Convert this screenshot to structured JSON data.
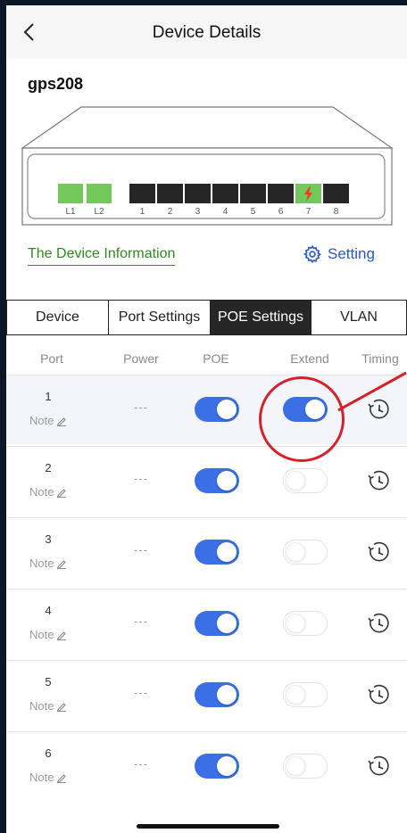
{
  "header": {
    "title": "Device Details"
  },
  "device": {
    "name": "gps208"
  },
  "switch_ports": {
    "uplinks": [
      "L1",
      "L2"
    ],
    "ports": [
      "1",
      "2",
      "3",
      "4",
      "5",
      "6",
      "7",
      "8"
    ]
  },
  "links": {
    "device_info": "The Device Information",
    "setting": "Setting"
  },
  "tabs": [
    {
      "label": "Device"
    },
    {
      "label": "Port Settings"
    },
    {
      "label": "POE Settings",
      "active": true
    },
    {
      "label": "VLAN"
    }
  ],
  "columns": {
    "port": "Port",
    "power": "Power",
    "poe": "POE",
    "extend": "Extend",
    "timing": "Timing"
  },
  "rows": [
    {
      "port": "1",
      "note": "Note",
      "power": "---",
      "poe": true,
      "extend": true
    },
    {
      "port": "2",
      "note": "Note",
      "power": "---",
      "poe": true,
      "extend": false
    },
    {
      "port": "3",
      "note": "Note",
      "power": "---",
      "poe": true,
      "extend": false
    },
    {
      "port": "4",
      "note": "Note",
      "power": "---",
      "poe": true,
      "extend": false
    },
    {
      "port": "5",
      "note": "Note",
      "power": "---",
      "poe": true,
      "extend": false
    },
    {
      "port": "6",
      "note": "Note",
      "power": "---",
      "poe": true,
      "extend": false
    }
  ],
  "colors": {
    "toggle_on": "#3b6fe3",
    "link_green": "#2f8a1e",
    "link_blue": "#2a56c8",
    "uplink_port": "#72c95a",
    "active_port": "#72c95a",
    "port_dark": "#262626",
    "annotation": "#d4212a"
  },
  "icons": {
    "back": "chevron-left-icon",
    "setting": "gear-icon",
    "note": "pencil-icon",
    "timing": "clock-timer-icon",
    "poe_active": "lightning-icon"
  }
}
